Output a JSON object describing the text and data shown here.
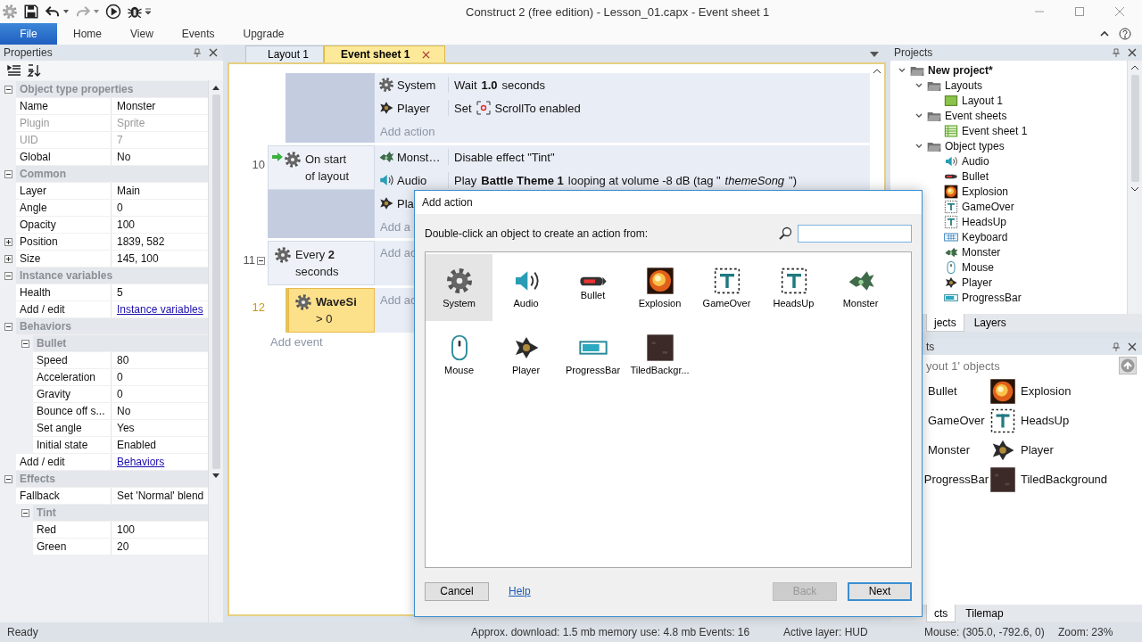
{
  "window": {
    "title": "Construct 2  (free edition) - Lesson_01.capx - Event sheet 1"
  },
  "ribbon_tabs": [
    {
      "label": "File",
      "selected": true
    },
    {
      "label": "Home",
      "selected": false
    },
    {
      "label": "View",
      "selected": false
    },
    {
      "label": "Events",
      "selected": false
    },
    {
      "label": "Upgrade",
      "selected": false
    }
  ],
  "properties": {
    "title": "Properties",
    "items": [
      {
        "kind": "group",
        "label": "Object type properties",
        "expanded": true,
        "children": [
          {
            "kind": "row",
            "name": "Name",
            "value": "Monster",
            "disabled": false
          },
          {
            "kind": "row",
            "name": "Plugin",
            "value": "Sprite",
            "disabled": true
          },
          {
            "kind": "row",
            "name": "UID",
            "value": "7",
            "disabled": true
          },
          {
            "kind": "row",
            "name": "Global",
            "value": "No",
            "disabled": false
          }
        ]
      },
      {
        "kind": "group",
        "label": "Common",
        "expanded": true,
        "children": [
          {
            "kind": "row",
            "name": "Layer",
            "value": "Main",
            "disabled": false
          },
          {
            "kind": "row",
            "name": "Angle",
            "value": "0",
            "disabled": false
          },
          {
            "kind": "row",
            "name": "Opacity",
            "value": "100",
            "disabled": false
          },
          {
            "kind": "row",
            "name": "Position",
            "value": "1839, 582",
            "disabled": false,
            "expanded": false
          },
          {
            "kind": "row",
            "name": "Size",
            "value": "145, 100",
            "disabled": false,
            "expanded": false
          }
        ]
      },
      {
        "kind": "group",
        "label": "Instance variables",
        "expanded": true,
        "children": [
          {
            "kind": "row",
            "name": "Health",
            "value": "5",
            "disabled": false
          },
          {
            "kind": "link",
            "name": "Add / edit",
            "value": "Instance variables"
          }
        ]
      },
      {
        "kind": "group",
        "label": "Behaviors",
        "expanded": true,
        "children": [
          {
            "kind": "group",
            "label": "Bullet",
            "expanded": true,
            "children": [
              {
                "kind": "row",
                "name": "Speed",
                "value": "80",
                "disabled": false
              },
              {
                "kind": "row",
                "name": "Acceleration",
                "value": "0",
                "disabled": false
              },
              {
                "kind": "row",
                "name": "Gravity",
                "value": "0",
                "disabled": false
              },
              {
                "kind": "row",
                "name": "Bounce off s...",
                "value": "No",
                "disabled": false
              },
              {
                "kind": "row",
                "name": "Set angle",
                "value": "Yes",
                "disabled": false
              },
              {
                "kind": "row",
                "name": "Initial state",
                "value": "Enabled",
                "disabled": false
              }
            ]
          },
          {
            "kind": "link",
            "name": "Add / edit",
            "value": "Behaviors"
          }
        ]
      },
      {
        "kind": "group",
        "label": "Effects",
        "expanded": true,
        "children": [
          {
            "kind": "row",
            "name": "Fallback",
            "value": "Set 'Normal' blend",
            "disabled": false
          },
          {
            "kind": "group",
            "label": "Tint",
            "expanded": true,
            "children": [
              {
                "kind": "row",
                "name": "Red",
                "value": "100",
                "disabled": false
              },
              {
                "kind": "row",
                "name": "Green",
                "value": "20",
                "disabled": false
              }
            ]
          }
        ]
      }
    ]
  },
  "document_tabs": [
    {
      "label": "Layout 1",
      "selected": false
    },
    {
      "label": "Event sheet 1",
      "selected": true
    }
  ],
  "events": [
    {
      "selected": false,
      "sub": false,
      "actions": [
        {
          "kind": "gear",
          "object": "System",
          "text": "Wait **1.0** seconds"
        },
        {
          "kind": "player",
          "object": "Player",
          "pre": "Set",
          "text": "ScrollTo enabled"
        }
      ],
      "add_action": "Add action"
    },
    {
      "number": "10",
      "selected": false,
      "sub": false,
      "condition": {
        "kind": "gear",
        "trigger": true,
        "text": "On start\nof layout"
      },
      "actions": [
        {
          "kind": "monster",
          "object": "Monst…",
          "text": "Disable effect \"Tint\""
        },
        {
          "kind": "speaker",
          "object": "Audio",
          "text": "Play **Battle Theme 1** looping at volume -8 dB (tag \"*themeSong*\")"
        },
        {
          "kind": "player",
          "object": "Pla"
        }
      ],
      "add_action": "Add a"
    },
    {
      "number": "11",
      "selected": false,
      "sub": false,
      "expanded": true,
      "condition": {
        "kind": "gear",
        "trigger": false,
        "text": "Every **2**\nseconds"
      },
      "add_action": "Add ac"
    },
    {
      "number": "12",
      "selected": true,
      "sub": true,
      "condition": {
        "kind": "gear",
        "trigger": false,
        "text": "**WaveSi**\n> 0"
      },
      "add_action": "Add ac"
    }
  ],
  "add_event": "Add event",
  "projects": {
    "title": "Projects",
    "tree": [
      {
        "label": "New project*",
        "kind": "folder",
        "expanded": true,
        "children": [
          {
            "label": "Layouts",
            "kind": "folder",
            "expanded": true,
            "children": [
              {
                "label": "Layout 1",
                "kind": "layout"
              }
            ]
          },
          {
            "label": "Event sheets",
            "kind": "folder",
            "expanded": true,
            "children": [
              {
                "label": "Event sheet 1",
                "kind": "sheet"
              }
            ]
          },
          {
            "label": "Object types",
            "kind": "folder",
            "expanded": true,
            "children": [
              {
                "label": "Audio",
                "kind": "speaker"
              },
              {
                "label": "Bullet",
                "kind": "bullet"
              },
              {
                "label": "Explosion",
                "kind": "explosion"
              },
              {
                "label": "GameOver",
                "kind": "text"
              },
              {
                "label": "HeadsUp",
                "kind": "text"
              },
              {
                "label": "Keyboard",
                "kind": "keyboard"
              },
              {
                "label": "Monster",
                "kind": "monster"
              },
              {
                "label": "Mouse",
                "kind": "mouse"
              },
              {
                "label": "Player",
                "kind": "player"
              },
              {
                "label": "ProgressBar",
                "kind": "bar"
              }
            ]
          }
        ]
      }
    ],
    "tabs": [
      {
        "label": "jects",
        "selected": true
      },
      {
        "label": "Layers",
        "selected": false
      }
    ]
  },
  "objects_panel": {
    "title": "ts",
    "filter": "yout 1' objects",
    "items": [
      {
        "label": "Bullet"
      },
      {
        "label": "Explosion",
        "kind": "explosion"
      },
      {
        "label": "GameOver"
      },
      {
        "label": "HeadsUp",
        "kind": "text"
      },
      {
        "label": "Monster"
      },
      {
        "label": "Player",
        "kind": "player"
      },
      {
        "label": "ProgressBar"
      },
      {
        "label": "TiledBackground",
        "kind": "tiled"
      }
    ],
    "tabs": [
      {
        "label": "cts",
        "selected": true
      },
      {
        "label": "Tilemap",
        "selected": false
      }
    ]
  },
  "dialog": {
    "title": "Add action",
    "instruction": "Double-click an object to create an action from:",
    "objects": [
      {
        "label": "System",
        "kind": "gear",
        "selected": true
      },
      {
        "label": "Audio",
        "kind": "speaker",
        "selected": false
      },
      {
        "label": "Bullet",
        "kind": "bullet",
        "selected": false
      },
      {
        "label": "Explosion",
        "kind": "explosion",
        "selected": false
      },
      {
        "label": "GameOver",
        "kind": "text",
        "selected": false
      },
      {
        "label": "HeadsUp",
        "kind": "text",
        "selected": false
      },
      {
        "label": "Monster",
        "kind": "monster",
        "selected": false
      },
      {
        "label": "Mouse",
        "kind": "mouse",
        "selected": false
      },
      {
        "label": "Player",
        "kind": "player",
        "selected": false
      },
      {
        "label": "ProgressBar",
        "kind": "bar",
        "selected": false
      },
      {
        "label": "TiledBackgr...",
        "kind": "tiled",
        "selected": false
      }
    ],
    "buttons": [
      {
        "label": "Cancel",
        "kind": "button",
        "disabled": false
      },
      {
        "label": "Help",
        "kind": "link"
      },
      {
        "label": "Back",
        "kind": "button",
        "disabled": true
      },
      {
        "label": "Next",
        "kind": "default",
        "disabled": false
      }
    ]
  },
  "status_bar": {
    "state": "Ready",
    "download": "Approx. download: 1.5 mb  memory use: 4.8 mb  Events: 16",
    "layer": "Active layer: HUD",
    "mouse": "Mouse: (305.0, -792.6, 0)",
    "zoom": "Zoom: 23%"
  }
}
